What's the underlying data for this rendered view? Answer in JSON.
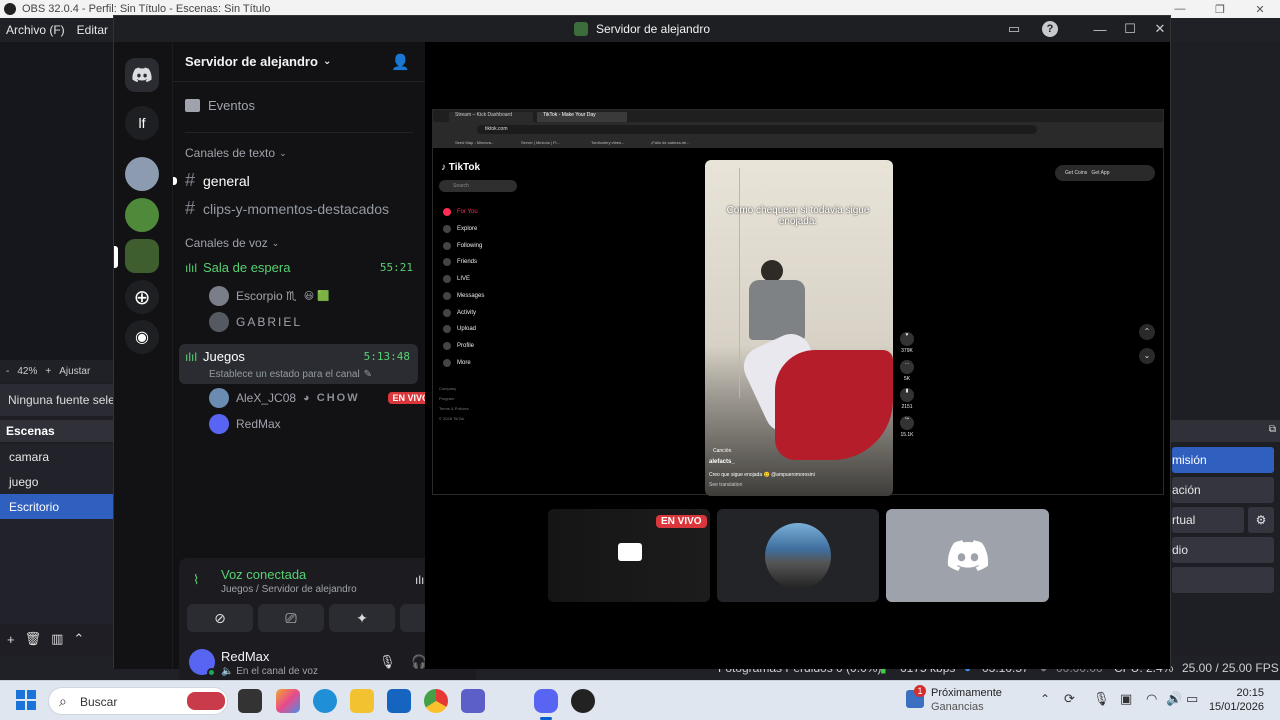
{
  "obs": {
    "title": "OBS 32.0.4 - Perfil: Sin Título - Escenas: Sin Título",
    "menu": [
      "Archivo (F)",
      "Editar"
    ],
    "zoom_minus": "-",
    "zoom": "42%",
    "zoom_plus": "+",
    "zoom_fit": "Ajustar",
    "no_source": "Ninguna fuente selec",
    "scenes_header": "Escenas",
    "scenes": [
      "camara",
      "juego",
      "Escritorio"
    ],
    "controls": [
      "misión",
      "ación",
      "rtual",
      "dio"
    ],
    "status": {
      "dropped": "Fotogramas Perdidos 0 (0.0%)",
      "kbps": "6175 kbps",
      "rec_time": "03:10:57",
      "stream_time": "00:00:00",
      "cpu": "CPU: 2.4%",
      "fps": "25.00 / 25.00 FPS"
    }
  },
  "discord": {
    "window_title": "Servidor de alejandro",
    "server_name": "Servidor de alejandro",
    "server_initials": "lf",
    "events": "Eventos",
    "text_category": "Canales de texto",
    "text_channels": [
      "general",
      "clips-y-momentos-destacados"
    ],
    "voice_category": "Canales de voz",
    "voice_channels": [
      {
        "name": "Sala de espera",
        "time": "55:21",
        "users": [
          "Escorpio ♏",
          "GABRIEL"
        ]
      },
      {
        "name": "Juegos",
        "time": "5:13:48",
        "status": "Establece un estado para el canal",
        "users": [
          "AleX_JC08",
          "RedMax"
        ],
        "extra": "CHOW",
        "badge": "EN VIVO"
      }
    ],
    "voice_panel": {
      "title": "Voz conectada",
      "subtitle": "Juegos / Servidor de alejandro"
    },
    "user": {
      "name": "RedMax",
      "status": "En el canal de voz"
    },
    "stream": {
      "tabs": [
        "Stream – Kick Dashboard",
        "TikTok - Make Your Day"
      ],
      "url": "tiktok.com",
      "bookmarks": [
        "Seed Map - Minecra...",
        "Server | Minions | Fi...",
        "Tomfoolery vibes...",
        "¡Fallo de cabeza de..."
      ],
      "brand": "TikTok",
      "search_placeholder": "Search",
      "nav": [
        "For You",
        "Explore",
        "Following",
        "Friends",
        "LIVE",
        "Messages",
        "Activity",
        "Upload",
        "Profile",
        "More"
      ],
      "footer": [
        "Company",
        "Program",
        "Terms & Policies",
        "© 2026 TikTok"
      ],
      "top_buttons": [
        "Get Coins",
        "Get App"
      ],
      "caption": "Como chequear si todavia sigue enojada:",
      "music_tag": "Canción",
      "author": "alefacts_",
      "desc": "Creo que sigue enojada 🥲 @ampueromorosini",
      "see_translation": "See translation",
      "likes": "379K",
      "comments": "5K",
      "saves": "2151",
      "shares": "15.1K"
    },
    "tile_badge": "EN VIVO"
  },
  "taskbar": {
    "search": "Buscar",
    "news_title": "Próximamente",
    "news_sub": "Ganancias",
    "news_count": "1",
    "time": "20:15",
    "date": "15/01/2026"
  }
}
